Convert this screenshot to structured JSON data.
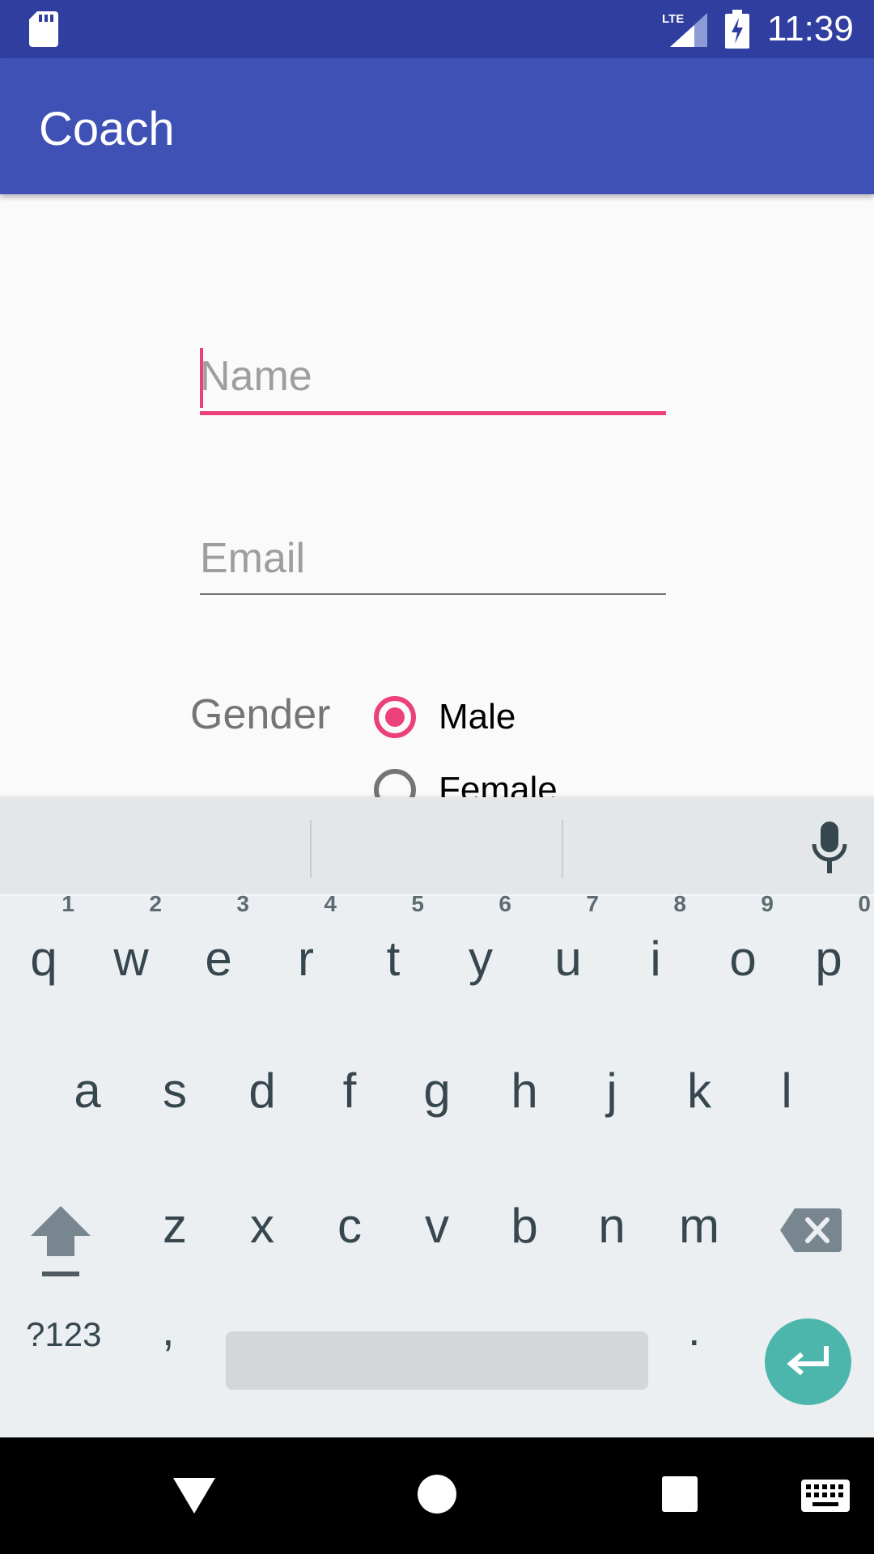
{
  "status_bar": {
    "time": "11:39",
    "network": "LTE",
    "icons": [
      "sd-card-icon",
      "lte-signal-icon",
      "battery-charging-icon"
    ]
  },
  "app_bar": {
    "title": "Coach"
  },
  "form": {
    "name_placeholder": "Name",
    "email_placeholder": "Email",
    "gender_label": "Gender",
    "gender_options": [
      "Male",
      "Female"
    ],
    "gender_selected": "Male"
  },
  "keyboard": {
    "row1": [
      {
        "key": "q",
        "hint": "1"
      },
      {
        "key": "w",
        "hint": "2"
      },
      {
        "key": "e",
        "hint": "3"
      },
      {
        "key": "r",
        "hint": "4"
      },
      {
        "key": "t",
        "hint": "5"
      },
      {
        "key": "y",
        "hint": "6"
      },
      {
        "key": "u",
        "hint": "7"
      },
      {
        "key": "i",
        "hint": "8"
      },
      {
        "key": "o",
        "hint": "9"
      },
      {
        "key": "p",
        "hint": "0"
      }
    ],
    "row2": [
      "a",
      "s",
      "d",
      "f",
      "g",
      "h",
      "j",
      "k",
      "l"
    ],
    "row3": [
      "z",
      "x",
      "c",
      "v",
      "b",
      "n",
      "m"
    ],
    "symbols_label": "?123",
    "comma_label": ",",
    "period_label": "."
  },
  "colors": {
    "status_bar": "#303f9f",
    "app_bar": "#3f51b5",
    "accent": "#ec407a",
    "enter_key": "#4db6ac"
  },
  "nav_bar": {
    "icons": [
      "back-icon",
      "home-icon",
      "recents-icon",
      "keyboard-switch-icon"
    ]
  }
}
